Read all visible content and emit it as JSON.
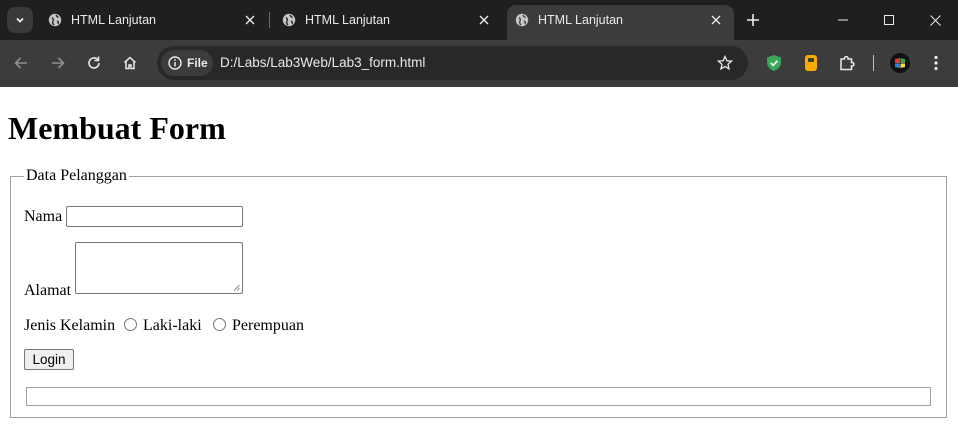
{
  "browser": {
    "tabs": [
      {
        "title": "HTML Lanjutan"
      },
      {
        "title": "HTML Lanjutan"
      },
      {
        "title": "HTML Lanjutan"
      }
    ],
    "omnibox": {
      "chip_label": "File",
      "url": "D:/Labs/Lab3Web/Lab3_form.html"
    }
  },
  "page": {
    "heading": "Membuat Form",
    "form": {
      "legend": "Data Pelanggan",
      "nama_label": "Nama",
      "nama_value": "",
      "alamat_label": "Alamat",
      "alamat_value": "",
      "gender_label": "Jenis Kelamin",
      "gender_options": [
        "Laki-laki",
        "Perempuan"
      ],
      "submit_label": "Login"
    }
  },
  "colors": {
    "tabstrip_bg": "#1f1f1f",
    "toolbar_bg": "#3c3c3c",
    "shield_green": "#3aa757",
    "bookmark_yellow": "#f9ab00"
  }
}
